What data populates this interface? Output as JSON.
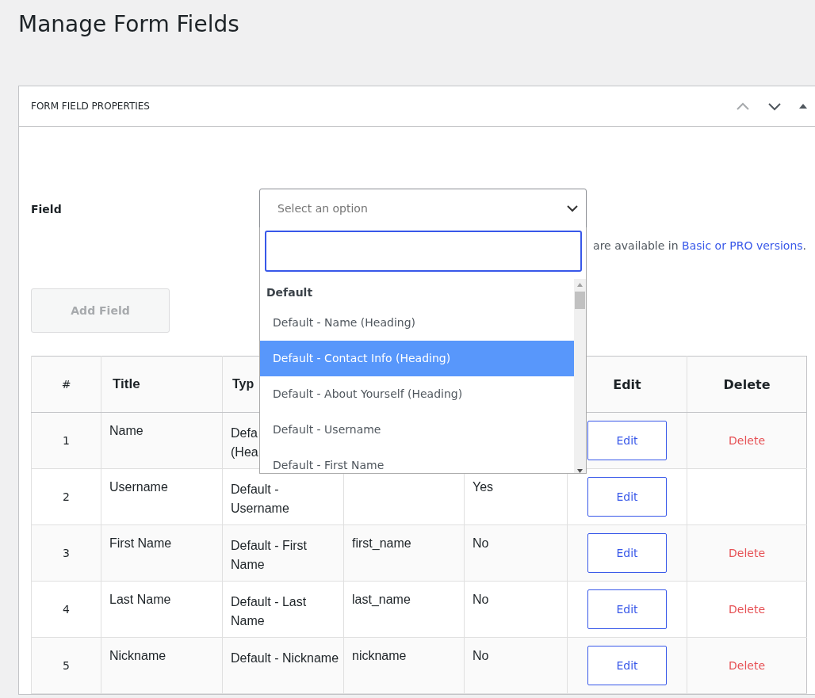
{
  "page_title": "Manage Form Fields",
  "panel": {
    "title": "FORM FIELD PROPERTIES"
  },
  "field": {
    "label": "Field",
    "placeholder": "Select an option",
    "expanded": true,
    "help_text": "are available in ",
    "help_link": "Basic or PRO versions",
    "help_end": "."
  },
  "dropdown": {
    "group": "Default",
    "options": [
      {
        "label": "Default - Name (Heading)",
        "selected": false
      },
      {
        "label": "Default - Contact Info (Heading)",
        "selected": true
      },
      {
        "label": "Default - About Yourself (Heading)",
        "selected": false
      },
      {
        "label": "Default - Username",
        "selected": false
      },
      {
        "label": "Default - First Name",
        "selected": false
      }
    ]
  },
  "add_button": {
    "label": "Add Field",
    "disabled": true
  },
  "table": {
    "columns": [
      {
        "label": "#"
      },
      {
        "label": "Title"
      },
      {
        "label": "Typ"
      },
      {
        "label": "Edit"
      },
      {
        "label": "Delete"
      }
    ],
    "rows": [
      {
        "number": "1",
        "title": "Name",
        "type": "Defa\n(Hea",
        "edit": "Edit",
        "delete": "Delete"
      },
      {
        "number": "2",
        "title": "Username",
        "type": "Default -\nUsername",
        "required": "Yes",
        "edit": "Edit"
      },
      {
        "number": "3",
        "title": "First Name",
        "type": "Default - First\nName",
        "field_name": "first_name",
        "required": "No",
        "edit": "Edit",
        "delete": "Delete"
      },
      {
        "number": "4",
        "title": "Last Name",
        "type": "Default - Last\nName",
        "field_name": "last_name",
        "required": "No",
        "edit": "Edit",
        "delete": "Delete"
      },
      {
        "number": "5",
        "title": "Nickname",
        "type": "Default - Nickname",
        "field_name": "nickname",
        "required": "No",
        "edit": "Edit",
        "delete": "Delete"
      }
    ]
  }
}
